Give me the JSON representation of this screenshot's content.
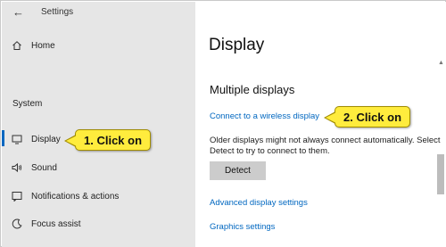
{
  "window": {
    "title": "Settings"
  },
  "sidebar": {
    "home_label": "Home",
    "section_label": "System",
    "items": [
      {
        "label": "Display",
        "icon": "monitor-icon",
        "selected": true
      },
      {
        "label": "Sound",
        "icon": "speaker-icon",
        "selected": false
      },
      {
        "label": "Notifications & actions",
        "icon": "notifications-icon",
        "selected": false
      },
      {
        "label": "Focus assist",
        "icon": "focus-assist-icon",
        "selected": false
      }
    ]
  },
  "main": {
    "title": "Display",
    "section_heading": "Multiple displays",
    "wireless_link": "Connect to a wireless display",
    "description": "Older displays might not always connect automatically. Select Detect to try to connect to them.",
    "detect_button": "Detect",
    "advanced_link": "Advanced display settings",
    "graphics_link": "Graphics settings"
  },
  "callouts": {
    "step1": "1. Click on",
    "step2": "2. Click on"
  },
  "colors": {
    "accent": "#0067c0",
    "sidebar_bg": "#e6e6e6",
    "callout_bg": "#ffec3d",
    "button_bg": "#cccccc"
  }
}
